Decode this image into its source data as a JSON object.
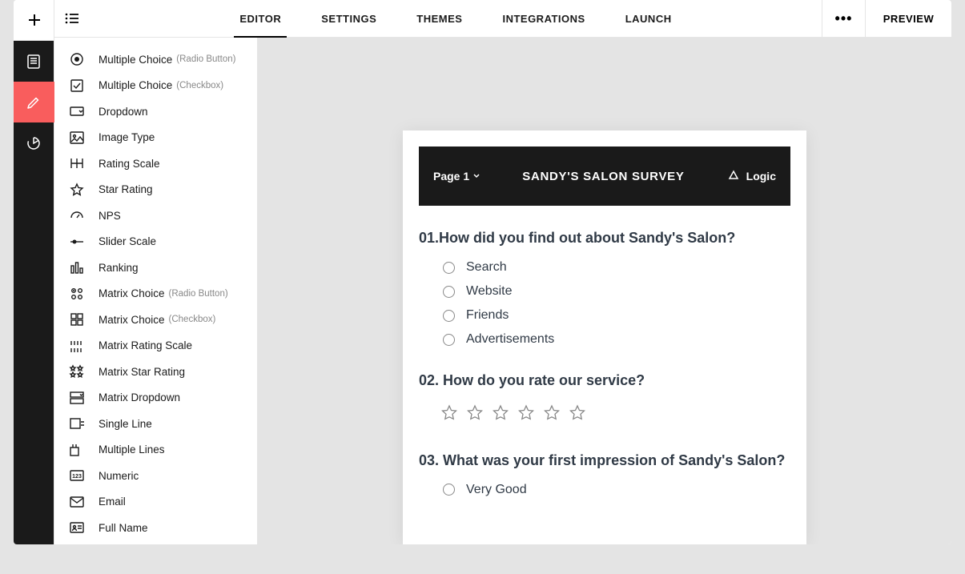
{
  "topbar": {
    "tabs": [
      "EDITOR",
      "SETTINGS",
      "THEMES",
      "INTEGRATIONS",
      "LAUNCH"
    ],
    "active_tab": 0,
    "preview": "PREVIEW"
  },
  "palette": [
    {
      "label": "Multiple Choice",
      "subtype": "(Radio Button)",
      "icon": "radio"
    },
    {
      "label": "Multiple Choice",
      "subtype": "(Checkbox)",
      "icon": "checkbox"
    },
    {
      "label": "Dropdown",
      "subtype": "",
      "icon": "dropdown"
    },
    {
      "label": "Image Type",
      "subtype": "",
      "icon": "image"
    },
    {
      "label": "Rating Scale",
      "subtype": "",
      "icon": "rating"
    },
    {
      "label": "Star Rating",
      "subtype": "",
      "icon": "star"
    },
    {
      "label": "NPS",
      "subtype": "",
      "icon": "gauge"
    },
    {
      "label": "Slider Scale",
      "subtype": "",
      "icon": "slider"
    },
    {
      "label": "Ranking",
      "subtype": "",
      "icon": "ranking"
    },
    {
      "label": "Matrix Choice",
      "subtype": "(Radio Button)",
      "icon": "matrix-radio"
    },
    {
      "label": "Matrix Choice",
      "subtype": "(Checkbox)",
      "icon": "matrix-check"
    },
    {
      "label": "Matrix Rating Scale",
      "subtype": "",
      "icon": "matrix-rating"
    },
    {
      "label": "Matrix Star Rating",
      "subtype": "",
      "icon": "matrix-star"
    },
    {
      "label": "Matrix Dropdown",
      "subtype": "",
      "icon": "matrix-dropdown"
    },
    {
      "label": "Single Line",
      "subtype": "",
      "icon": "single-line"
    },
    {
      "label": "Multiple Lines",
      "subtype": "",
      "icon": "multi-line"
    },
    {
      "label": "Numeric",
      "subtype": "",
      "icon": "numeric"
    },
    {
      "label": "Email",
      "subtype": "",
      "icon": "email"
    },
    {
      "label": "Full Name",
      "subtype": "",
      "icon": "fullname"
    }
  ],
  "survey": {
    "page_label": "Page 1",
    "title": "SANDY'S SALON SURVEY",
    "logic": "Logic",
    "questions": [
      {
        "num": "01.",
        "text": "How did you find out about Sandy's Salon?",
        "type": "radio",
        "options": [
          "Search",
          "Website",
          "Friends",
          "Advertisements"
        ]
      },
      {
        "num": "02. ",
        "text": "How do you rate our service?",
        "type": "star",
        "star_count": 6
      },
      {
        "num": "03. ",
        "text": "What was your first impression of Sandy's Salon?",
        "type": "radio",
        "options": [
          "Very Good"
        ]
      }
    ]
  }
}
